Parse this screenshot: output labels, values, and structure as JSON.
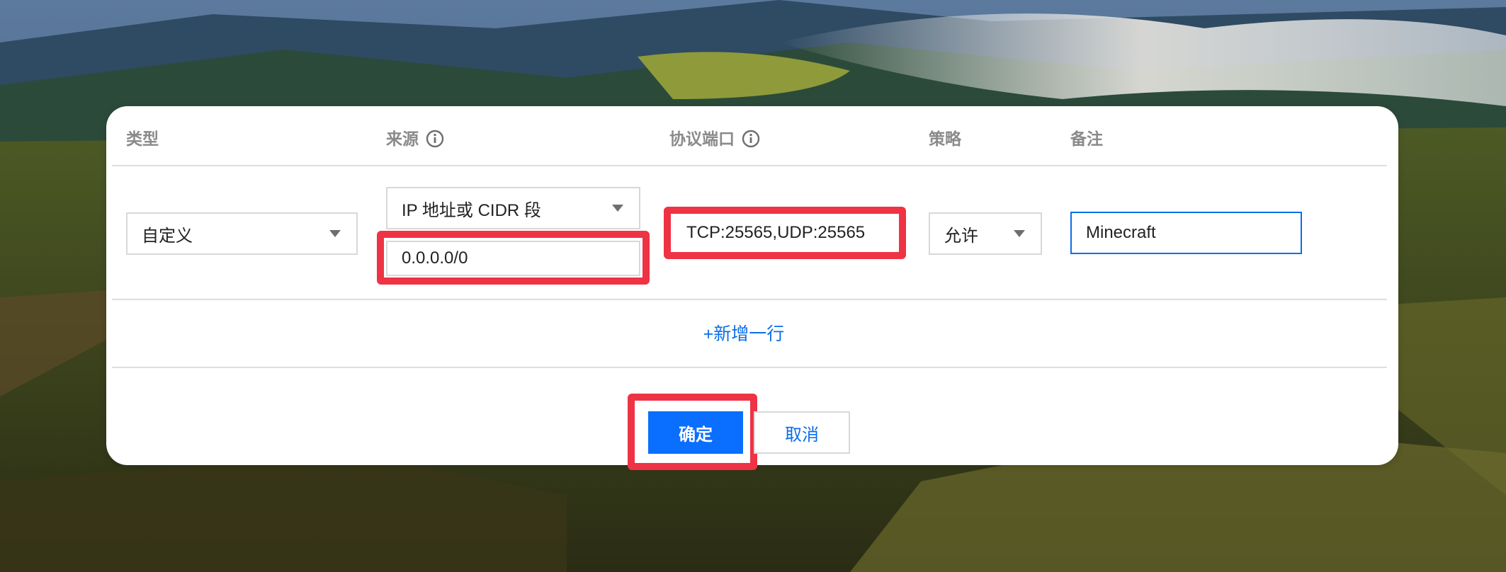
{
  "table": {
    "headers": {
      "type": "类型",
      "source": "来源",
      "protocol_port": "协议端口",
      "policy": "策略",
      "note": "备注"
    },
    "row": {
      "type_value": "自定义",
      "source_type_value": "IP 地址或 CIDR 段",
      "source_value": "0.0.0.0/0",
      "protocol_port_value": "TCP:25565,UDP:25565",
      "policy_value": "允许",
      "note_value": "Minecraft"
    }
  },
  "actions": {
    "add_row": "+新增一行",
    "confirm": "确定",
    "cancel": "取消"
  },
  "colors": {
    "accent": "#0a6eff",
    "highlight": "#ee3345",
    "header_text": "#8a8a8a"
  },
  "icons": {
    "info": "info-circle-icon",
    "dropdown": "caret-down-icon"
  }
}
